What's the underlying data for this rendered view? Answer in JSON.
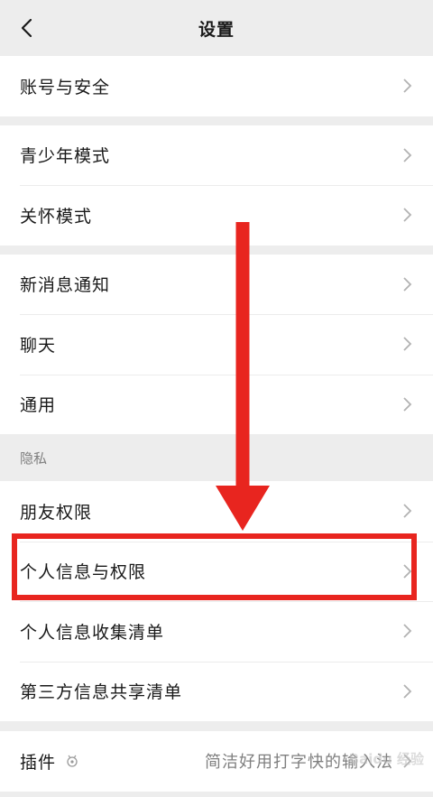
{
  "header": {
    "title": "设置"
  },
  "groups": {
    "g1": [
      "账号与安全"
    ],
    "g2": [
      "青少年模式",
      "关怀模式"
    ],
    "g3": [
      "新消息通知",
      "聊天",
      "通用"
    ],
    "privacy_label": "隐私",
    "g4": [
      "朋友权限",
      "个人信息与权限",
      "个人信息收集清单",
      "第三方信息共享清单"
    ],
    "plugin": {
      "label": "插件",
      "value": "简洁好用打字快的输入法"
    }
  },
  "watermark": "Baidu 经验",
  "colors": {
    "accent_red": "#e8251f",
    "background": "#ededed",
    "text": "#191919",
    "secondary": "#7f7f7f"
  },
  "icons": {
    "back": "chevron-left-icon",
    "row": "chevron-right-icon",
    "plugin": "plugin-badge-icon"
  }
}
